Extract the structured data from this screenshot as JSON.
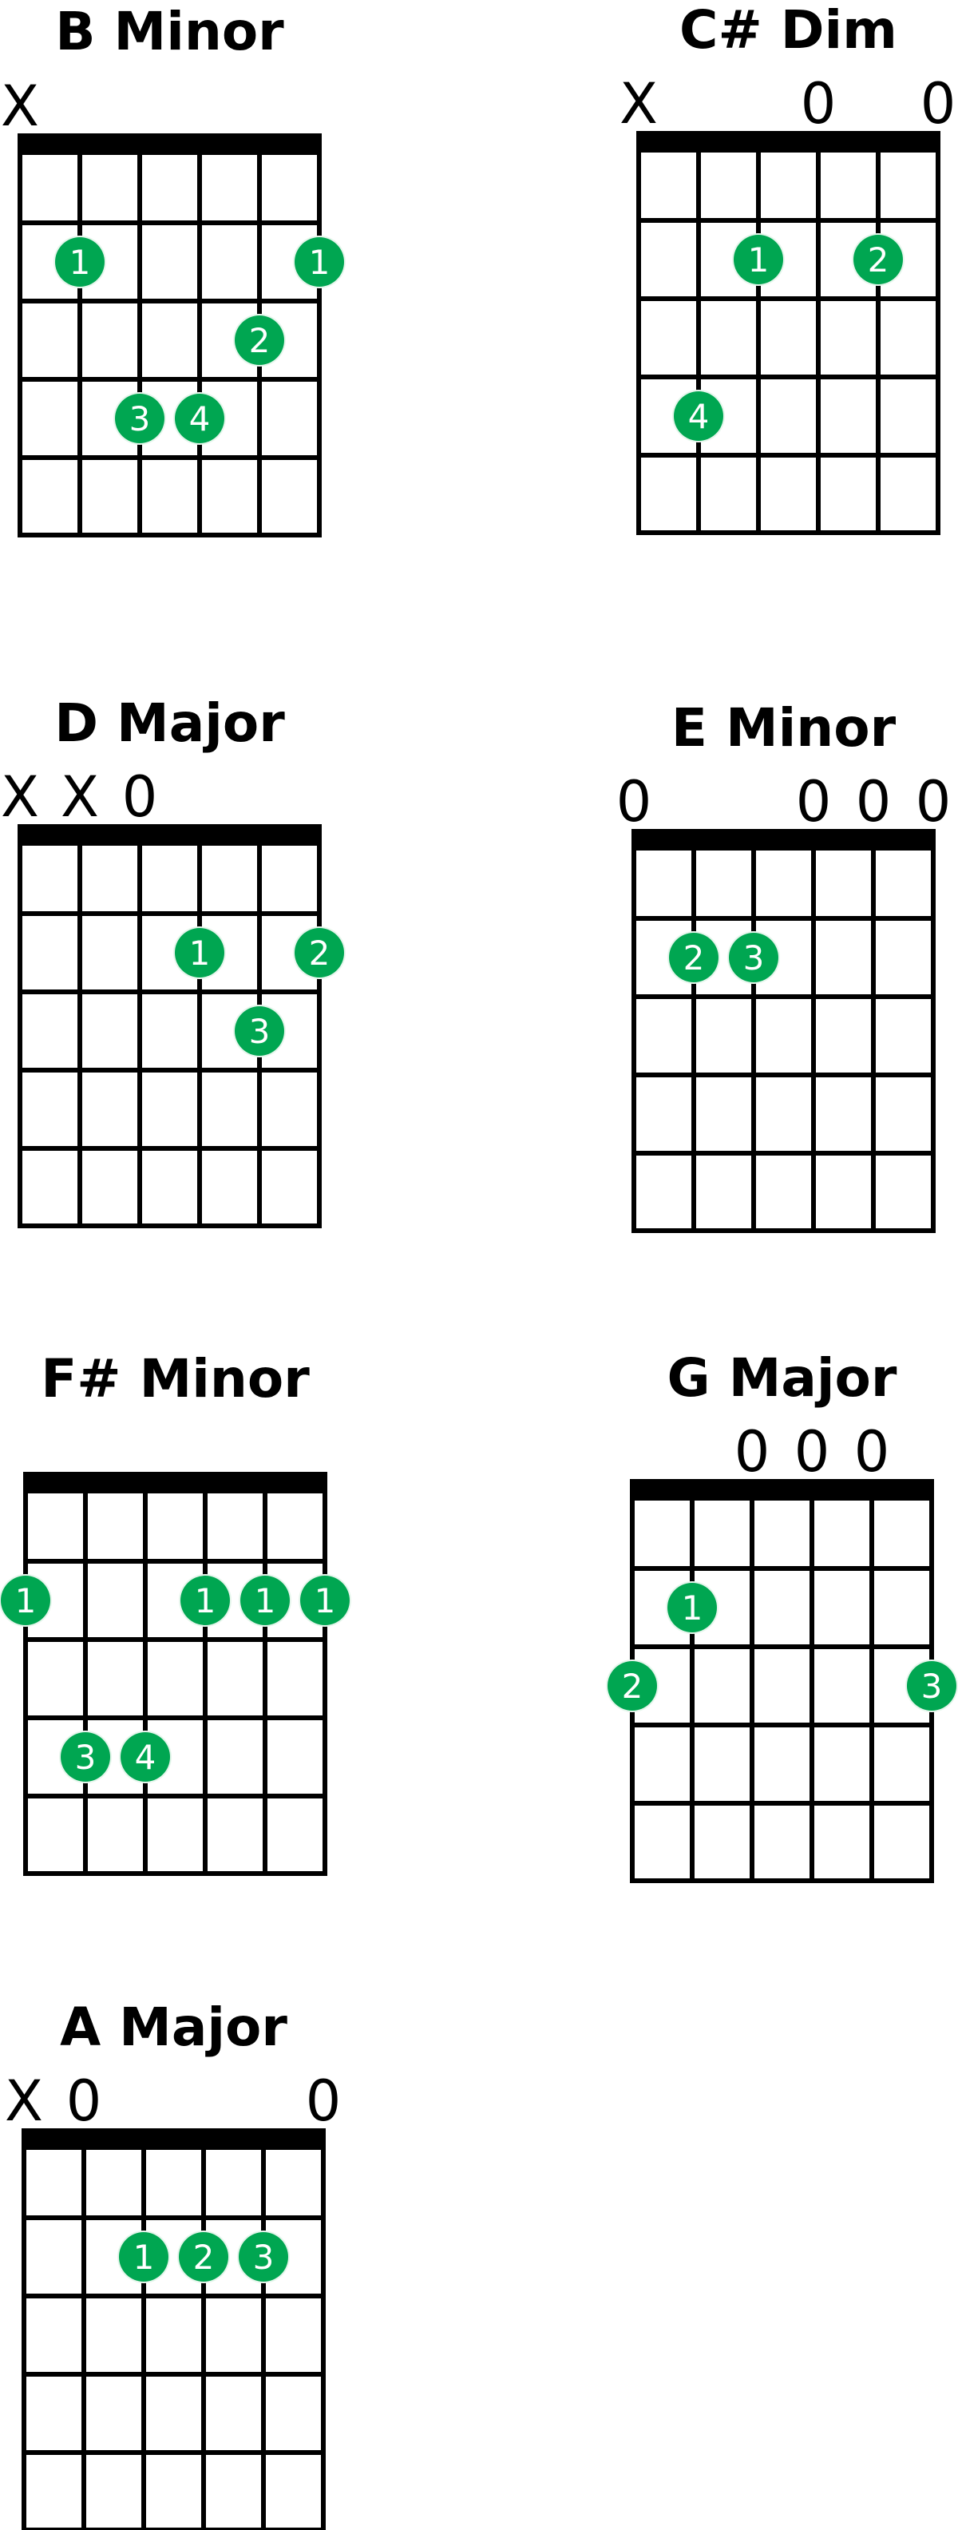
{
  "colors": {
    "dot": "#00A651",
    "dot_halo": "#E6F6EC",
    "line": "#000000",
    "finger_text": "#FFFFFF"
  },
  "strings_per_chart": 6,
  "frets_shown": 5,
  "charts": [
    {
      "name": "B Minor",
      "markers": [
        "X",
        "",
        "",
        "",
        "",
        ""
      ],
      "fingers": [
        {
          "string": 2,
          "fret": 2,
          "finger": "1"
        },
        {
          "string": 6,
          "fret": 2,
          "finger": "1"
        },
        {
          "string": 5,
          "fret": 3,
          "finger": "2"
        },
        {
          "string": 3,
          "fret": 4,
          "finger": "3"
        },
        {
          "string": 4,
          "fret": 4,
          "finger": "4"
        }
      ]
    },
    {
      "name": "C# Dim",
      "markers": [
        "X",
        "",
        "",
        "0",
        "",
        "0"
      ],
      "fingers": [
        {
          "string": 3,
          "fret": 2,
          "finger": "1"
        },
        {
          "string": 5,
          "fret": 2,
          "finger": "2"
        },
        {
          "string": 2,
          "fret": 4,
          "finger": "4"
        }
      ]
    },
    {
      "name": "D Major",
      "markers": [
        "X",
        "X",
        "0",
        "",
        "",
        ""
      ],
      "fingers": [
        {
          "string": 4,
          "fret": 2,
          "finger": "1"
        },
        {
          "string": 6,
          "fret": 2,
          "finger": "2"
        },
        {
          "string": 5,
          "fret": 3,
          "finger": "3"
        }
      ]
    },
    {
      "name": "E Minor",
      "markers": [
        "0",
        "",
        "",
        "0",
        "0",
        "0"
      ],
      "fingers": [
        {
          "string": 2,
          "fret": 2,
          "finger": "2"
        },
        {
          "string": 3,
          "fret": 2,
          "finger": "3"
        }
      ]
    },
    {
      "name": "F# Minor",
      "markers": [
        "",
        "",
        "",
        "",
        "",
        ""
      ],
      "fingers": [
        {
          "string": 1,
          "fret": 2,
          "finger": "1"
        },
        {
          "string": 4,
          "fret": 2,
          "finger": "1"
        },
        {
          "string": 5,
          "fret": 2,
          "finger": "1"
        },
        {
          "string": 6,
          "fret": 2,
          "finger": "1"
        },
        {
          "string": 2,
          "fret": 4,
          "finger": "3"
        },
        {
          "string": 3,
          "fret": 4,
          "finger": "4"
        }
      ]
    },
    {
      "name": "G Major",
      "markers": [
        "",
        "",
        "0",
        "0",
        "0",
        ""
      ],
      "fingers": [
        {
          "string": 2,
          "fret": 2,
          "finger": "1"
        },
        {
          "string": 1,
          "fret": 3,
          "finger": "2"
        },
        {
          "string": 6,
          "fret": 3,
          "finger": "3"
        }
      ]
    },
    {
      "name": "A Major",
      "markers": [
        "X",
        "0",
        "",
        "",
        "",
        "0"
      ],
      "fingers": [
        {
          "string": 3,
          "fret": 2,
          "finger": "1"
        },
        {
          "string": 4,
          "fret": 2,
          "finger": "2"
        },
        {
          "string": 5,
          "fret": 2,
          "finger": "3"
        }
      ]
    }
  ]
}
